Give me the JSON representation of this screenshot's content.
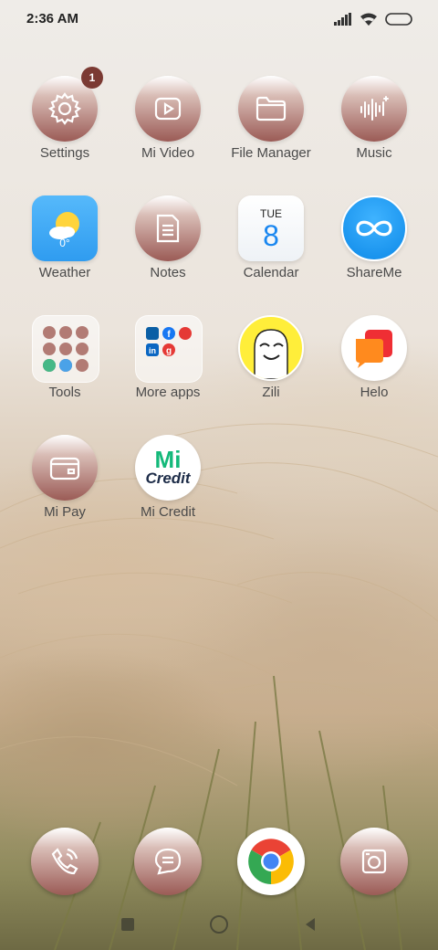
{
  "status_bar": {
    "time": "2:36 AM"
  },
  "apps": {
    "settings": {
      "label": "Settings",
      "badge": "1"
    },
    "mi_video": {
      "label": "Mi Video"
    },
    "file_manager": {
      "label": "File Manager"
    },
    "music": {
      "label": "Music"
    },
    "weather": {
      "label": "Weather",
      "temp": "0°"
    },
    "notes": {
      "label": "Notes"
    },
    "calendar": {
      "label": "Calendar",
      "weekday": "TUE",
      "day": "8"
    },
    "shareme": {
      "label": "ShareMe"
    },
    "tools": {
      "label": "Tools"
    },
    "more_apps": {
      "label": "More apps"
    },
    "zili": {
      "label": "Zili"
    },
    "helo": {
      "label": "Helo"
    },
    "mi_pay": {
      "label": "Mi Pay"
    },
    "mi_credit": {
      "label": "Mi Credit",
      "logo_top": "Mi",
      "logo_bottom": "Credit"
    }
  },
  "dock": [
    "phone-icon",
    "messages-icon",
    "chrome-icon",
    "camera-icon"
  ],
  "colors": {
    "theme_dark": "#9b5b56",
    "badge": "#7b3a33",
    "weather_bg": "#3aa9f5",
    "shareme_bg": "#1a9bf0"
  }
}
